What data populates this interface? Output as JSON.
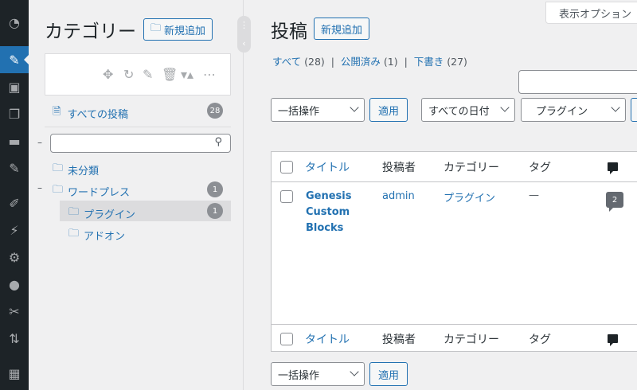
{
  "adminbar": {
    "items": [
      "dashboard-icon",
      "posts-icon",
      "media-icon",
      "pages-icon",
      "comments-icon",
      "pin-icon",
      "appearance-icon",
      "plugins-icon",
      "settings-icon",
      "users-icon",
      "tools-icon",
      "sort-icon",
      "qr-icon"
    ]
  },
  "categories": {
    "title": "カテゴリー",
    "add_label": "新規追加",
    "all_posts_label": "すべての投稿",
    "all_posts_count": "28",
    "tree": [
      {
        "label": "未分類",
        "count": ""
      },
      {
        "label": "ワードプレス",
        "count": "1"
      },
      {
        "label": "プラグイン",
        "count": "1"
      },
      {
        "label": "アドオン",
        "count": ""
      }
    ]
  },
  "screen_options": "表示オプション",
  "main": {
    "title": "投稿",
    "add_label": "新規追加",
    "filters": {
      "all": "すべて",
      "all_count": "(28)",
      "published": "公開済み",
      "published_count": "(1)",
      "draft": "下書き",
      "draft_count": "(27)"
    },
    "bulk_action": "一括操作",
    "apply": "適用",
    "date_filter": "すべての日付",
    "category_filter": "プラグイン",
    "columns": {
      "title": "タイトル",
      "author": "投稿者",
      "categories": "カテゴリー",
      "tags": "タグ"
    },
    "rows": [
      {
        "title": "Genesis Custom Blocks",
        "author": "admin",
        "category": "プラグイン",
        "tags": "—",
        "comments": "2"
      }
    ]
  }
}
